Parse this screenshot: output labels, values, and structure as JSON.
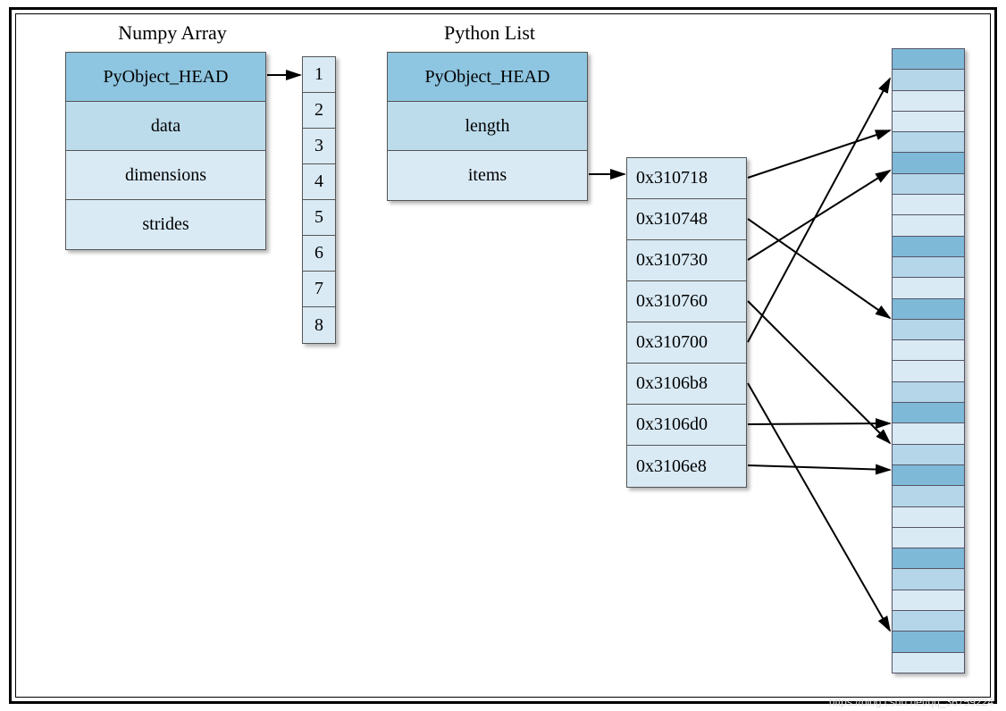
{
  "numpy": {
    "title": "Numpy Array",
    "rows": [
      "PyObject_HEAD",
      "data",
      "dimensions",
      "strides"
    ]
  },
  "list": {
    "title": "Python List",
    "rows": [
      "PyObject_HEAD",
      "length",
      "items"
    ]
  },
  "numbers": [
    "1",
    "2",
    "3",
    "4",
    "5",
    "6",
    "7",
    "8"
  ],
  "pointers": [
    "0x310718",
    "0x310748",
    "0x310730",
    "0x310760",
    "0x310700",
    "0x3106b8",
    "0x3106d0",
    "0x3106e8"
  ],
  "memory_cells": 30,
  "watermark": "https://blog.csdn.net/qq_36759224"
}
